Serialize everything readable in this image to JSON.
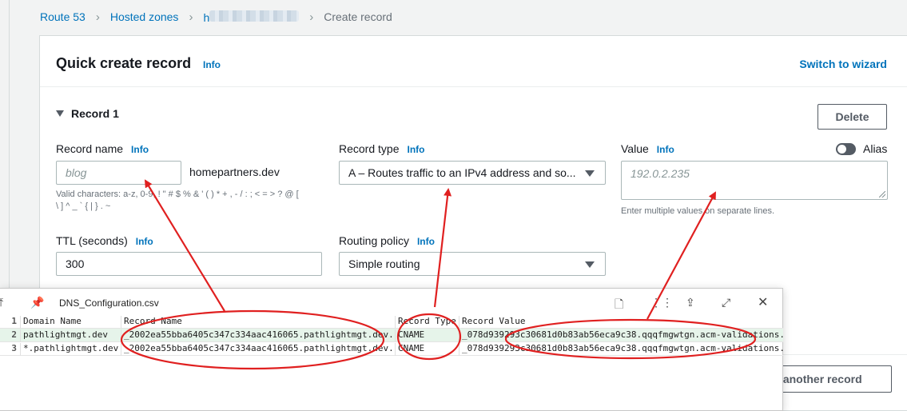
{
  "breadcrumb": {
    "items": [
      "Route 53",
      "Hosted zones",
      "h",
      "Create record"
    ]
  },
  "panel": {
    "title": "Quick create record",
    "info": "Info",
    "switch_wizard": "Switch to wizard"
  },
  "record": {
    "section_label": "Record 1",
    "delete_label": "Delete",
    "record_name": {
      "label": "Record name",
      "info": "Info",
      "placeholder": "blog",
      "suffix": "homepartners.dev",
      "hint_line1": "Valid characters: a-z, 0-9, ! \" # $ % & ' ( ) * + , - / : ; < = > ? @ [",
      "hint_line2": "\\ ] ^ _ ` { | } . ~"
    },
    "record_type": {
      "label": "Record type",
      "info": "Info",
      "value": "A – Routes traffic to an IPv4 address and so..."
    },
    "value": {
      "label": "Value",
      "info": "Info",
      "placeholder": "192.0.2.235",
      "hint": "Enter multiple values on separate lines."
    },
    "alias_label": "Alias",
    "alias_enabled": false,
    "ttl": {
      "label": "TTL (seconds)",
      "info": "Info",
      "value": "300"
    },
    "routing_policy": {
      "label": "Routing policy",
      "info": "Info",
      "value": "Simple routing"
    },
    "add_record_label": "d another record"
  },
  "csv_viewer": {
    "file_name": "DNS_Configuration.csv",
    "icons": [
      "pin-icon",
      "open-file-icon",
      "grid-icon",
      "share-icon",
      "expand-icon",
      "close-icon"
    ],
    "headers": [
      "1",
      "Domain Name",
      "Record Name",
      "Record Type",
      "Record Value"
    ],
    "rows": [
      [
        "2",
        "pathlightmgt.dev",
        "_2002ea55bba6405c347c334aac416065.pathlightmgt.dev.",
        "CNAME",
        "_078d939293c30681d0b83ab56eca9c38.qqqfmgwtgn.acm-validations."
      ],
      [
        "3",
        "*.pathlightmgt.dev",
        "_2002ea55bba6405c347c334aac416065.pathlightmgt.dev.",
        "CNAME",
        "_078d939293c30681d0b83ab56eca9c38.qqqfmgwtgn.acm-validations."
      ]
    ]
  },
  "colors": {
    "link": "#0073bb",
    "annotation": "#e02020",
    "selected_row": "#e6f4ea"
  }
}
